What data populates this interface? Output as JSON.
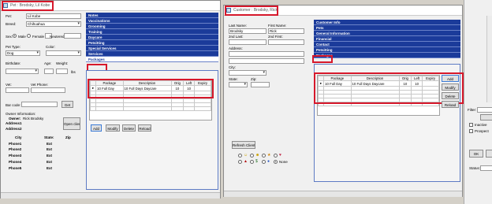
{
  "pet_window": {
    "title": "Pet : Brodsky, Lil Kobe",
    "pet_label": "Pet:",
    "pet_value": "Lil Kobe",
    "breed_label": "Breed:",
    "breed_value": "Chihuahua",
    "sex_label": "Sex:",
    "sex_male": "Male",
    "sex_female": "Female",
    "neutered": "Neutered",
    "pet_type_label": "Pet Type:",
    "pet_type_value": "Dog",
    "color_label": "Color:",
    "birthdate_label": "Birthdate:",
    "age_label": "Age:",
    "weight_label": "Weight:",
    "weight_unit": "lbs",
    "vet_label": "Vet:",
    "vet_phone_label": "Vet Phone:",
    "barcode_label": "Bar code:",
    "get_button": "Get",
    "owner_info_label": "Owner Information:",
    "owner_label": "Owner:",
    "owner_value": "Rick Brodsky",
    "open_client": "Open client",
    "address1": "Address1",
    "address2": "Address2",
    "city": "City",
    "state": "State:",
    "zip": "Zip",
    "phones": [
      {
        "label": "Phone1",
        "ext": "Ext"
      },
      {
        "label": "Phone2",
        "ext": "Ext"
      },
      {
        "label": "Phone3",
        "ext": "Ext"
      },
      {
        "label": "Phone4",
        "ext": "Ext"
      },
      {
        "label": "Phone5",
        "ext": "Ext"
      }
    ],
    "nav": [
      "Notes",
      "Vaccinations",
      "Grooming",
      "Training",
      "Daycare",
      "Petsitting",
      "Special Services",
      "Services",
      "Packages"
    ],
    "grid_headers": [
      "Package",
      "Description",
      "Orig",
      "Left",
      "Expiry"
    ],
    "grid_row": {
      "package": "10 Full Day",
      "description": "10 Full Days Daycare",
      "orig": "10",
      "left": "10",
      "expiry": ""
    },
    "buttons": {
      "add": "Add",
      "modify": "Modify",
      "delete": "Delete",
      "reload": "Reload"
    }
  },
  "customer_window": {
    "title": "Customer : Brodsky, Rick",
    "last_name_label": "Last Name:",
    "last_name_value": "Brodsky",
    "first_name_label": "First Name:",
    "first_name_value": "Rick",
    "second_last_label": "2nd Last:",
    "second_first_label": "2nd First:",
    "address_label": "Address:",
    "city_label": "City:",
    "state_label": "State:",
    "zip_label": "Zip:",
    "nav": [
      "Customer Info",
      "Pets",
      "General Information",
      "Financial",
      "Contact",
      "Petsitting",
      "Packages"
    ],
    "grid_headers": [
      "Package",
      "Description",
      "Orig",
      "Left",
      "Expiry"
    ],
    "grid_row": {
      "package": "10 Full Day",
      "description": "10 Full Days Daycare",
      "orig": "10",
      "left": "10",
      "expiry": ""
    },
    "buttons": {
      "add": "Add",
      "modify": "Modify",
      "delete": "Delete",
      "reload": "Reload"
    },
    "refresh_client": "Refresh Client",
    "none_label": "None"
  },
  "right_panel": {
    "filter_label": "Filter:",
    "inactive": "Inactive",
    "prospect": "Prospect",
    "ok": "OK",
    "status_label": "Status:"
  },
  "colors": {
    "nav_blue": "#1b3b9a",
    "highlight_red": "#d6182b"
  }
}
